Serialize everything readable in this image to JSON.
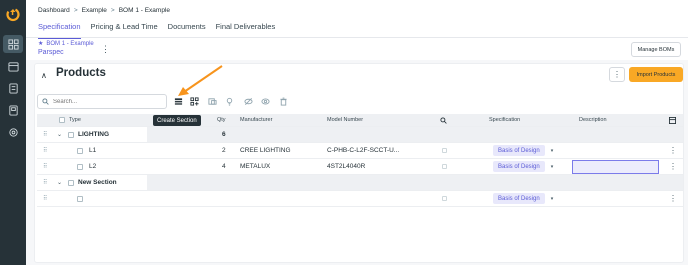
{
  "breadcrumb": {
    "items": [
      "Dashboard",
      "Example",
      "BOM 1 - Example"
    ],
    "sep": ">"
  },
  "tabs": [
    "Specification",
    "Pricing & Lead Time",
    "Documents",
    "Final Deliverables"
  ],
  "project": {
    "name": "BOM 1 - Example",
    "subtitle": "Parspec"
  },
  "header": {
    "manage_label": "Manage BOMs",
    "dots": "⋮"
  },
  "products": {
    "title": "Products",
    "collapse_glyph": "∧",
    "import_label": "Import Products",
    "dots": "⋮"
  },
  "search": {
    "placeholder": "Search..."
  },
  "tooltip": "Create Section",
  "columns": {
    "type": "Type",
    "qty": "Qty",
    "manufacturer": "Manufacturer",
    "model": "Model Number",
    "specification": "Specification",
    "description": "Description"
  },
  "rows": [
    {
      "kind": "section",
      "type": "LIGHTING",
      "qty": "6"
    },
    {
      "kind": "item",
      "type": "L1",
      "qty": "2",
      "manufacturer": "CREE LIGHTING",
      "model": "C-PHB-C-L2F-SCCT-U...",
      "spec": "Basis of Design"
    },
    {
      "kind": "item",
      "type": "L2",
      "qty": "4",
      "manufacturer": "METALUX",
      "model": "4ST2L4040R",
      "spec": "Basis of Design"
    },
    {
      "kind": "section",
      "type": "New Section"
    },
    {
      "kind": "item",
      "type": "",
      "spec": "Basis of Design"
    }
  ],
  "glyphs": {
    "drag": "⠿",
    "chevron": "⌄",
    "caret": "▾",
    "kebab": "⋮",
    "star": "★"
  },
  "colors": {
    "sidebar": "#263238",
    "accent": "#5b5bd6",
    "import": "#f9a825",
    "arrow": "#f7941d",
    "pill_bg": "#e8e8fb"
  },
  "icons": [
    "logo-icon",
    "dashboard-icon",
    "calendar-icon",
    "document-icon",
    "book-icon",
    "settings-icon",
    "search-icon",
    "create-section-icon",
    "add-product-icon",
    "kit-icon",
    "lightbulb-icon",
    "hide-icon",
    "view-icon",
    "delete-icon",
    "columns-icon"
  ]
}
